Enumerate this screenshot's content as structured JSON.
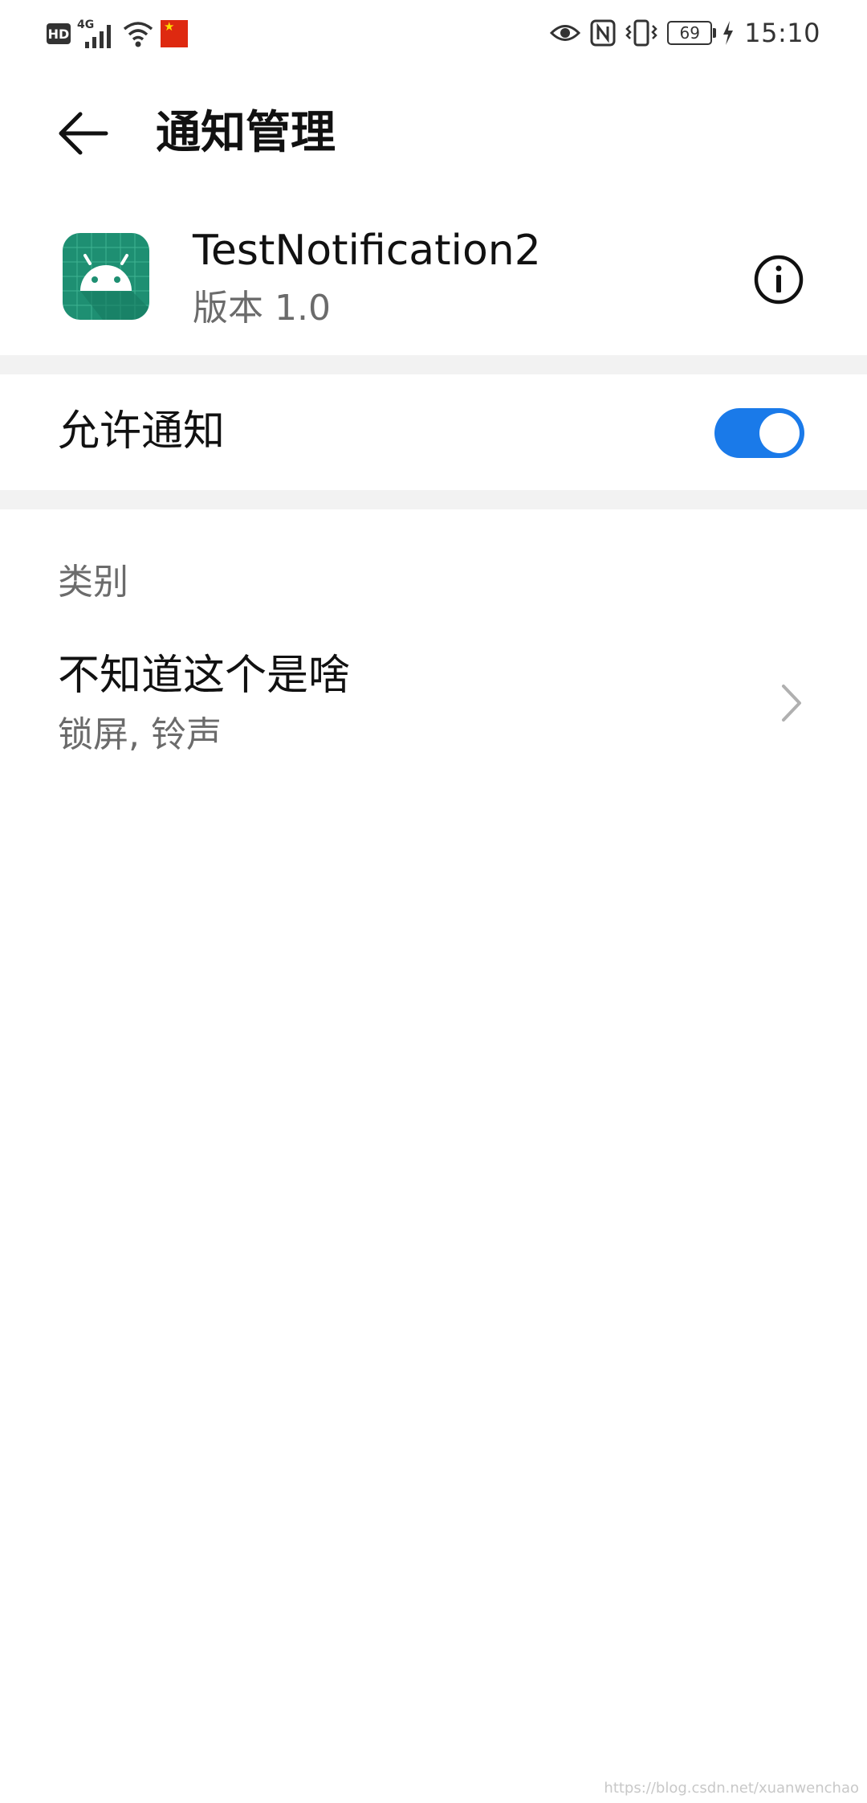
{
  "status_bar": {
    "hd_label": "HD",
    "network_label": "4G",
    "battery_level": "69",
    "time": "15:10",
    "icons_left": [
      "hd-icon",
      "signal-icon",
      "wifi-icon",
      "flag-icon"
    ],
    "icons_right": [
      "eye-icon",
      "nfc-icon",
      "vibrate-icon",
      "battery-icon",
      "charging-icon"
    ]
  },
  "header": {
    "title": "通知管理"
  },
  "app": {
    "name": "TestNotification2",
    "version": "版本 1.0",
    "icon_color": "#1e8f72"
  },
  "allow_notifications": {
    "label": "允许通知",
    "enabled": true,
    "accent_color": "#1a7ae9"
  },
  "categories": {
    "header": "类别",
    "items": [
      {
        "title": "不知道这个是啥",
        "subtitle": "锁屏, 铃声"
      }
    ]
  },
  "watermark": "https://blog.csdn.net/xuanwenchao"
}
